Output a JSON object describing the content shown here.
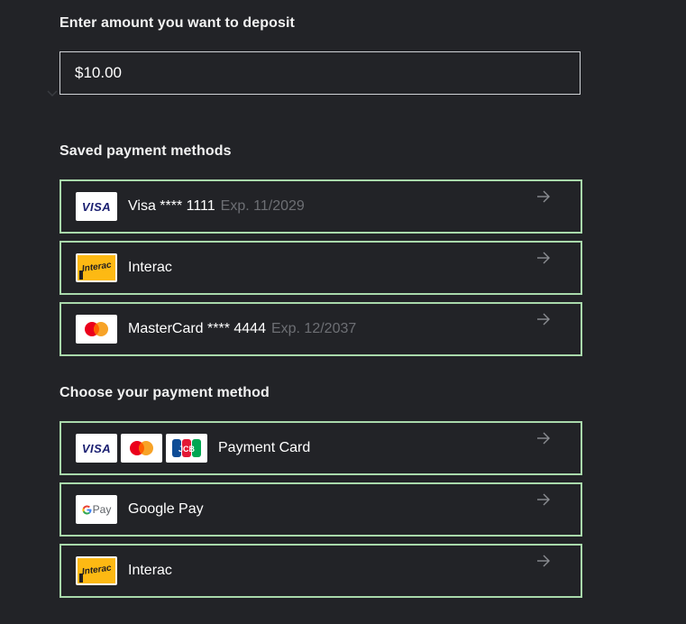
{
  "deposit": {
    "title": "Enter amount you want to deposit",
    "amount_value": "$10.00"
  },
  "saved": {
    "title": "Saved payment methods",
    "items": [
      {
        "logo": "visa",
        "name": "Visa **** 1111",
        "exp": "Exp. 11/2029"
      },
      {
        "logo": "interac",
        "name": "Interac",
        "exp": ""
      },
      {
        "logo": "mastercard",
        "name": "MasterCard **** 4444",
        "exp": "Exp. 12/2037"
      }
    ]
  },
  "choose": {
    "title": "Choose your payment method",
    "items": [
      {
        "logos": [
          "visa",
          "mastercard",
          "jcb"
        ],
        "name": "Payment Card"
      },
      {
        "logos": [
          "google-pay"
        ],
        "name": "Google Pay"
      },
      {
        "logos": [
          "interac"
        ],
        "name": "Interac"
      }
    ]
  },
  "logo_text": {
    "visa": "VISA",
    "interac": "Interac",
    "jcb": "JCB",
    "gpay": "Pay"
  },
  "colors": {
    "background": "#222327",
    "row_border": "#a9d9ab",
    "expiry_text": "#6d6f74",
    "visa_blue": "#1a1f71",
    "mastercard_red": "#eb001b",
    "mastercard_orange": "#f79e1b",
    "interac_yellow": "#fdb913"
  },
  "icons": {
    "row_arrow": "arrow-right-icon",
    "amount_chevron": "chevron-down-icon"
  }
}
